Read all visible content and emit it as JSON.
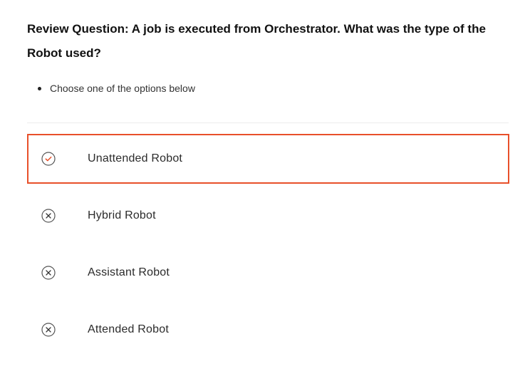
{
  "question": {
    "text": "Review Question: A job is executed from Orchestrator. What was the type of the Robot used?"
  },
  "instructions": [
    "Choose one of the options below"
  ],
  "options": [
    {
      "label": "Unattended Robot",
      "icon": "check-circle-icon",
      "selected": true
    },
    {
      "label": "Hybrid Robot",
      "icon": "x-circle-icon",
      "selected": false
    },
    {
      "label": "Assistant Robot",
      "icon": "x-circle-icon",
      "selected": false
    },
    {
      "label": "Attended Robot",
      "icon": "x-circle-icon",
      "selected": false
    }
  ],
  "colors": {
    "accent": "#e8502a",
    "icon_neutral": "#555555",
    "divider": "#ececec"
  }
}
